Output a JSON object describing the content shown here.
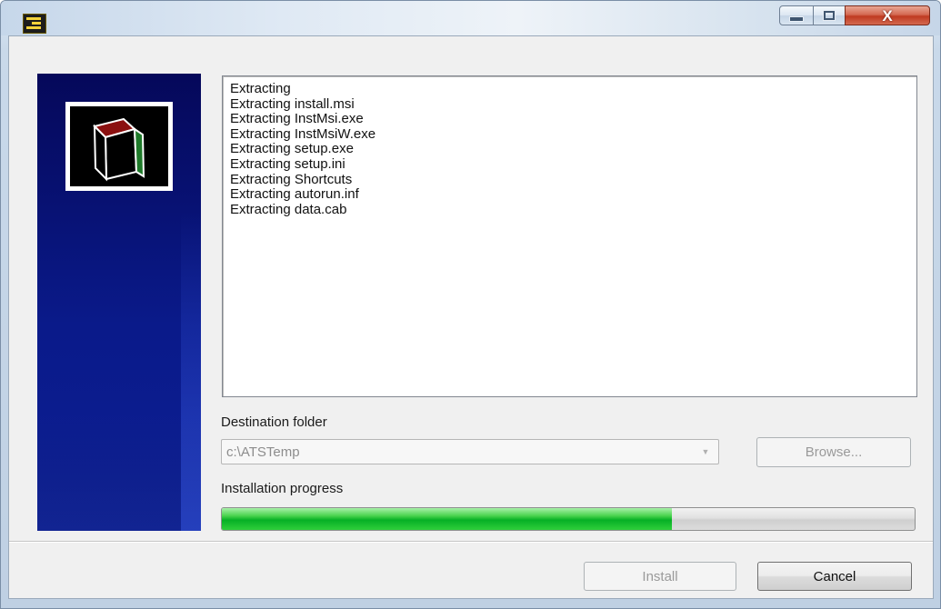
{
  "window": {
    "title": "",
    "app_icon": "installer-app-icon",
    "controls": {
      "minimize_icon": "minimize-icon",
      "maximize_icon": "maximize-icon",
      "close_icon": "close-icon",
      "close_glyph": "X"
    },
    "colors": {
      "banner": "#0a1a8a",
      "progress": "#06b025",
      "close_button": "#c7432a"
    }
  },
  "banner": {
    "icon": "box-package-icon"
  },
  "log": {
    "lines": [
      "Extracting",
      "Extracting install.msi",
      "Extracting InstMsi.exe",
      "Extracting InstMsiW.exe",
      "Extracting setup.exe",
      "Extracting setup.ini",
      "Extracting Shortcuts",
      "Extracting autorun.inf",
      "Extracting data.cab"
    ]
  },
  "destination": {
    "label": "Destination folder",
    "value": "c:\\ATSTemp",
    "browse_label": "Browse..."
  },
  "progress": {
    "label": "Installation progress",
    "fraction": 0.65
  },
  "footer": {
    "install_label": "Install",
    "cancel_label": "Cancel"
  }
}
